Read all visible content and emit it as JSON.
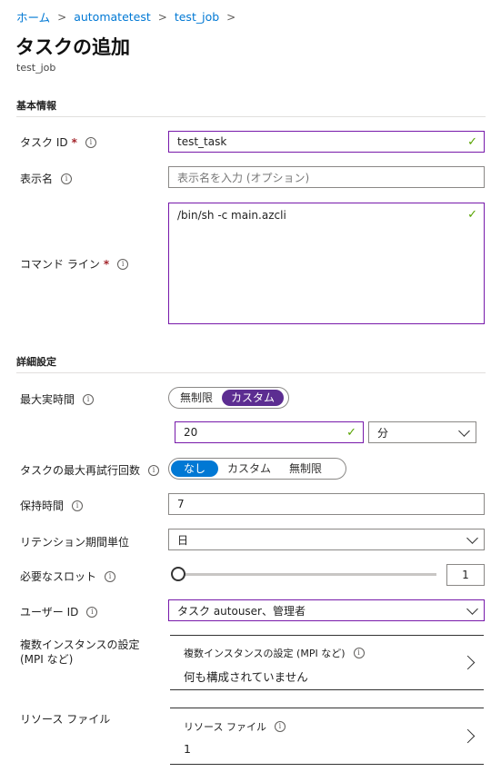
{
  "breadcrumb": [
    "ホーム",
    "automatetest",
    "test_job"
  ],
  "page": {
    "title": "タスクの追加",
    "subtitle": "test_job"
  },
  "sections": {
    "basic": "基本情報",
    "advanced": "詳細設定"
  },
  "task_id": {
    "label": "タスク ID",
    "value": "test_task"
  },
  "display_name": {
    "label": "表示名",
    "placeholder": "表示名を入力 (オプション)"
  },
  "command_line": {
    "label": "コマンド ライン",
    "value": "/bin/sh -c main.azcli"
  },
  "max_runtime": {
    "label": "最大実時間",
    "options": [
      "無制限",
      "カスタム"
    ],
    "selected": "カスタム",
    "value": "20",
    "unit": "分"
  },
  "max_retry": {
    "label": "タスクの最大再試行回数",
    "options": [
      "なし",
      "カスタム",
      "無制限"
    ],
    "selected": "なし"
  },
  "retention": {
    "label": "保持時間",
    "value": "7"
  },
  "retention_unit": {
    "label": "リテンション期間単位",
    "value": "日"
  },
  "slots": {
    "label": "必要なスロット",
    "value": "1",
    "slider_fraction": 0
  },
  "user_id": {
    "label": "ユーザー ID",
    "value": "タスク autouser、管理者"
  },
  "multi_instance": {
    "label": "複数インスタンスの設定 (MPI など)",
    "card_title": "複数インスタンスの設定 (MPI など)",
    "card_value": "何も構成されていません"
  },
  "resource_files": {
    "label": "リソース ファイル",
    "card_title": "リソース ファイル",
    "card_value": "1"
  },
  "colors": {
    "link": "#0078d4",
    "accent": "#7719aa",
    "toggle_purple": "#5c2d91",
    "toggle_blue": "#0078d4",
    "required": "#a4262c",
    "check": "#57a300"
  },
  "icons": {
    "info": "info-icon",
    "check": "checkmark-icon",
    "dropdown": "chevron-down-icon",
    "open": "chevron-right-icon"
  }
}
